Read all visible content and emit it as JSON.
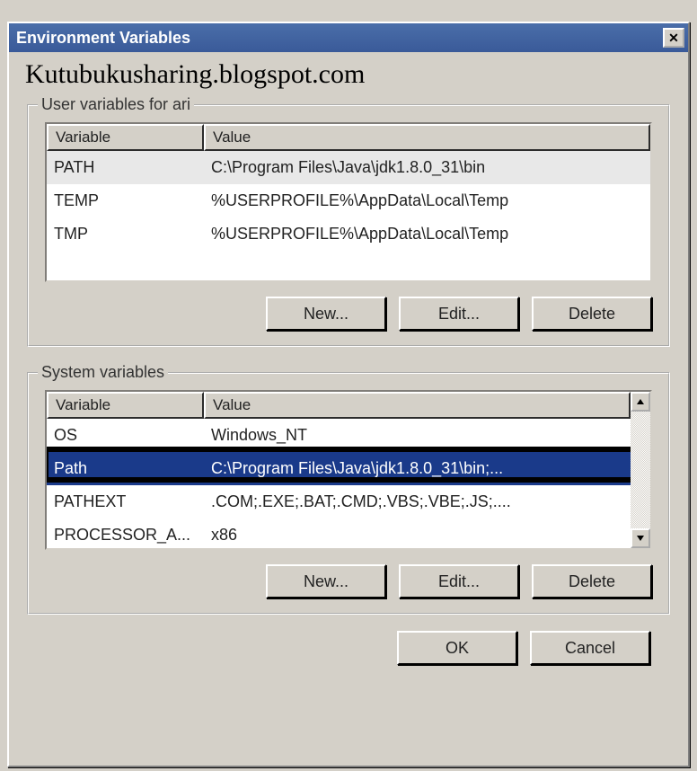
{
  "title": "Environment Variables",
  "watermark": "Kutubukusharing.blogspot.com",
  "userGroup": {
    "label": "User variables for ari",
    "headers": {
      "variable": "Variable",
      "value": "Value"
    },
    "rows": [
      {
        "var": "PATH",
        "val": "C:\\Program Files\\Java\\jdk1.8.0_31\\bin",
        "selected": true
      },
      {
        "var": "TEMP",
        "val": "%USERPROFILE%\\AppData\\Local\\Temp"
      },
      {
        "var": "TMP",
        "val": "%USERPROFILE%\\AppData\\Local\\Temp"
      }
    ],
    "buttons": {
      "new": "New...",
      "edit": "Edit...",
      "delete": "Delete"
    }
  },
  "systemGroup": {
    "label": "System variables",
    "headers": {
      "variable": "Variable",
      "value": "Value"
    },
    "rows": [
      {
        "var": "OS",
        "val": "Windows_NT"
      },
      {
        "var": "Path",
        "val": "C:\\Program Files\\Java\\jdk1.8.0_31\\bin;...",
        "selected": true
      },
      {
        "var": "PATHEXT",
        "val": ".COM;.EXE;.BAT;.CMD;.VBS;.VBE;.JS;...."
      },
      {
        "var": "PROCESSOR_A...",
        "val": "x86"
      }
    ],
    "buttons": {
      "new": "New...",
      "edit": "Edit...",
      "delete": "Delete"
    }
  },
  "dialogButtons": {
    "ok": "OK",
    "cancel": "Cancel"
  }
}
